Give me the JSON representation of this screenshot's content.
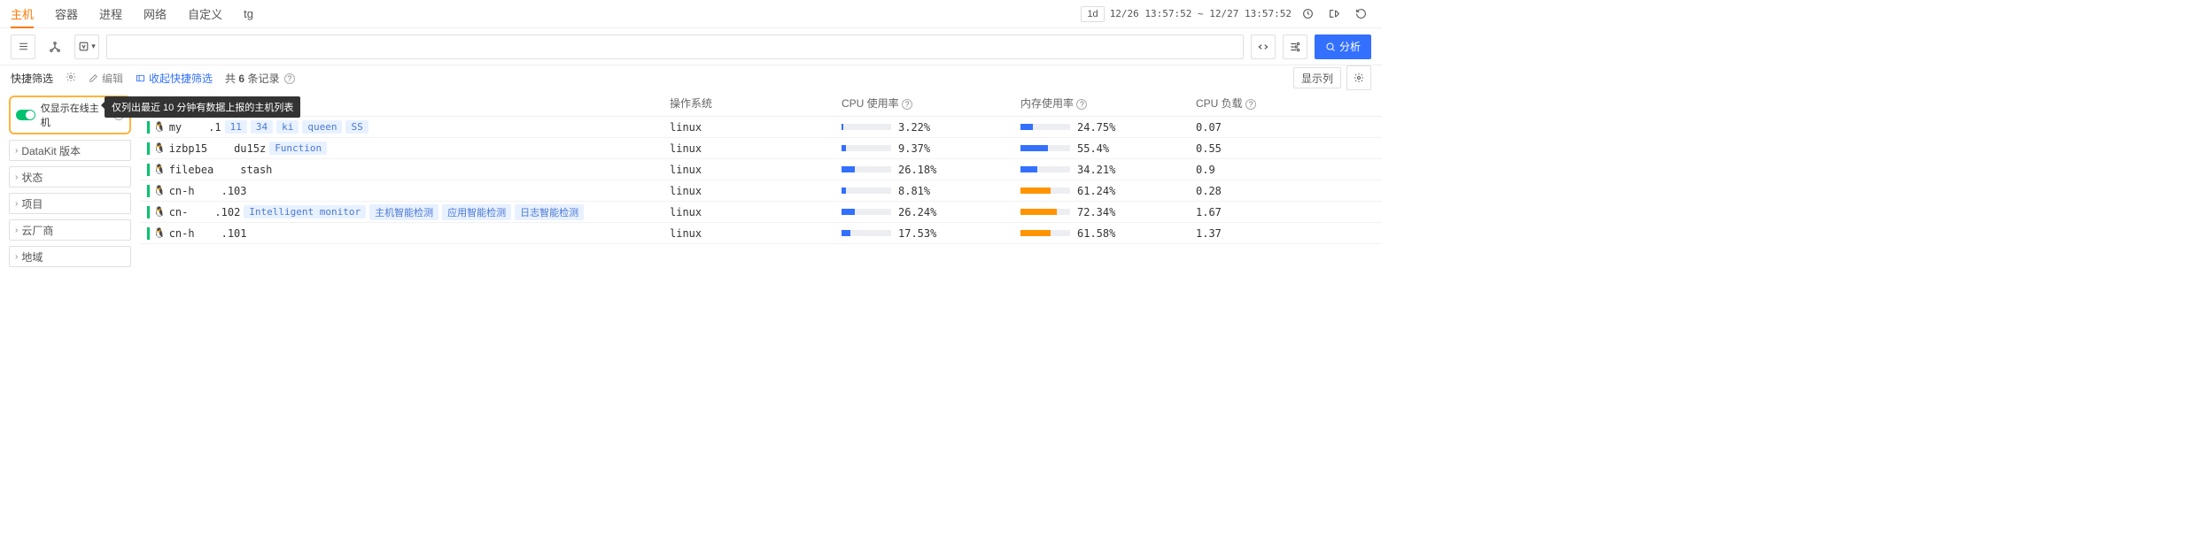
{
  "tabs": {
    "items": [
      "主机",
      "容器",
      "进程",
      "网络",
      "自定义",
      "tg"
    ],
    "active": 0
  },
  "time": {
    "preset": "1d",
    "range": "12/26 13:57:52 ~ 12/27 13:57:52"
  },
  "toolbar": {
    "analyze": "分析"
  },
  "filter": {
    "title": "快捷筛选",
    "edit": "编辑",
    "collapse": "收起快捷筛选",
    "count_prefix": "共",
    "count_value": "6",
    "count_suffix": "条记录",
    "show_columns": "显示列"
  },
  "sidebar": {
    "online_label": "仅显示在线主机",
    "tooltip": "仅列出最近 10 分钟有数据上报的主机列表",
    "items": [
      "DataKit 版本",
      "状态",
      "项目",
      "云厂商",
      "地域"
    ]
  },
  "table": {
    "headers": {
      "host": "",
      "os": "操作系统",
      "cpu": "CPU 使用率",
      "mem": "内存使用率",
      "load": "CPU 负载"
    },
    "rows": [
      {
        "host_parts": [
          "my",
          ".1"
        ],
        "tags": [
          "11",
          "34",
          "ki",
          "queen",
          "SS"
        ],
        "os": "linux",
        "cpu": "3.22%",
        "cpu_w": "3.22%",
        "mem": "24.75%",
        "mem_w": "24.75%",
        "mem_color": "blue",
        "load": "0.07"
      },
      {
        "host_parts": [
          "izbp15",
          "du15z"
        ],
        "tags": [
          "Function"
        ],
        "os": "linux",
        "cpu": "9.37%",
        "cpu_w": "9.37%",
        "mem": "55.4%",
        "mem_w": "55.4%",
        "mem_color": "blue",
        "load": "0.55"
      },
      {
        "host_parts": [
          "filebea",
          "stash"
        ],
        "tags": [],
        "os": "linux",
        "cpu": "26.18%",
        "cpu_w": "26.18%",
        "mem": "34.21%",
        "mem_w": "34.21%",
        "mem_color": "blue",
        "load": "0.9"
      },
      {
        "host_parts": [
          "cn-h",
          ".103"
        ],
        "tags": [],
        "os": "linux",
        "cpu": "8.81%",
        "cpu_w": "8.81%",
        "mem": "61.24%",
        "mem_w": "61.24%",
        "mem_color": "orange",
        "load": "0.28"
      },
      {
        "host_parts": [
          "cn-",
          ".102"
        ],
        "tags": [
          "Intelligent monitor",
          "主机智能检测",
          "应用智能检测",
          "日志智能检测"
        ],
        "os": "linux",
        "cpu": "26.24%",
        "cpu_w": "26.24%",
        "mem": "72.34%",
        "mem_w": "72.34%",
        "mem_color": "orange",
        "load": "1.67"
      },
      {
        "host_parts": [
          "cn-h",
          ".101"
        ],
        "tags": [],
        "os": "linux",
        "cpu": "17.53%",
        "cpu_w": "17.53%",
        "mem": "61.58%",
        "mem_w": "61.58%",
        "mem_color": "orange",
        "load": "1.37"
      }
    ]
  }
}
